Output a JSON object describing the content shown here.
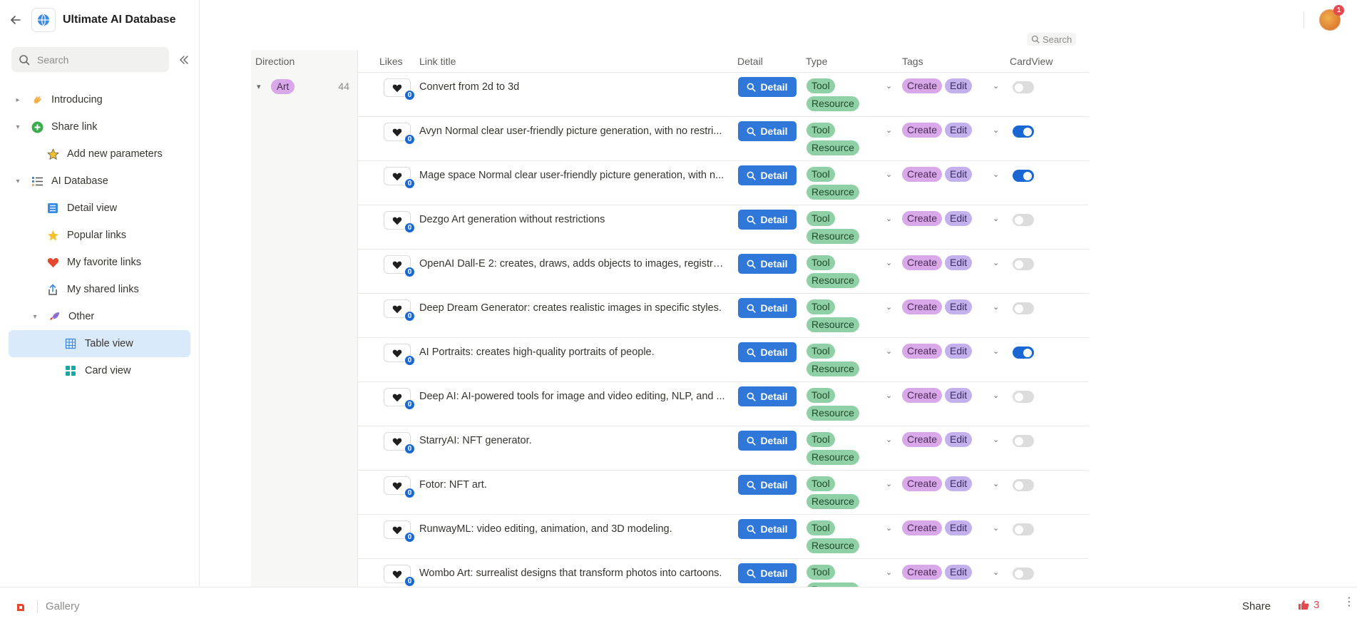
{
  "app": {
    "title": "Ultimate AI Database"
  },
  "sidebar": {
    "search_placeholder": "Search",
    "items": [
      {
        "label": "Introducing",
        "icon": "waving-hand-icon"
      },
      {
        "label": "Share link",
        "icon": "plus-circle-icon"
      },
      {
        "label": "Add new parameters",
        "icon": "sparkle-star-icon"
      },
      {
        "label": "AI Database",
        "icon": "list-icon"
      },
      {
        "label": "Detail view",
        "icon": "document-list-icon"
      },
      {
        "label": "Popular links",
        "icon": "star-icon"
      },
      {
        "label": "My favorite links",
        "icon": "heart-icon"
      },
      {
        "label": "My shared links",
        "icon": "share-upload-icon"
      },
      {
        "label": "Other",
        "icon": "rocket-icon"
      },
      {
        "label": "Table view",
        "icon": "table-grid-icon"
      },
      {
        "label": "Card view",
        "icon": "card-grid-icon"
      }
    ]
  },
  "table": {
    "search_label": "Search",
    "columns": {
      "direction": "Direction",
      "likes": "Likes",
      "link_title": "Link title",
      "detail": "Detail",
      "type": "Type",
      "tags": "Tags",
      "cardview": "CardView"
    },
    "group": {
      "name": "Art",
      "count": "44"
    },
    "detail_label": "Detail",
    "type_labels": {
      "tool": "Tool",
      "resource": "Resource"
    },
    "tag_labels": {
      "create": "Create",
      "edit": "Edit"
    },
    "rows": [
      {
        "likes": "0",
        "title": "Convert from 2d to 3d",
        "cardview": false
      },
      {
        "likes": "0",
        "title": "Avyn Normal clear user-friendly picture generation, with no restri...",
        "cardview": true
      },
      {
        "likes": "0",
        "title": "Mage space Normal clear user-friendly picture generation, with n...",
        "cardview": true
      },
      {
        "likes": "0",
        "title": "Dezgo Art generation without restrictions",
        "cardview": false
      },
      {
        "likes": "0",
        "title": "OpenAI Dall-E 2: creates, draws, adds objects to images, registra...",
        "cardview": false
      },
      {
        "likes": "0",
        "title": "Deep Dream Generator: creates realistic images in specific styles.",
        "cardview": false
      },
      {
        "likes": "0",
        "title": "AI Portraits: creates high-quality portraits of people.",
        "cardview": true
      },
      {
        "likes": "0",
        "title": "Deep AI: AI-powered tools for image and video editing, NLP, and ...",
        "cardview": false
      },
      {
        "likes": "0",
        "title": "StarryAI: NFT generator.",
        "cardview": false
      },
      {
        "likes": "0",
        "title": "Fotor: NFT art.",
        "cardview": false
      },
      {
        "likes": "0",
        "title": "RunwayML: video editing, animation, and 3D modeling.",
        "cardview": false
      },
      {
        "likes": "0",
        "title": "Wombo Art: surrealist designs that transform photos into cartoons.",
        "cardview": false
      }
    ]
  },
  "header": {
    "notification_count": "1"
  },
  "footer": {
    "gallery": "Gallery",
    "share": "Share",
    "likes": "3"
  },
  "colors": {
    "accent": "#2f77d8",
    "toggle_on": "#1967d2",
    "tag_green": "#8fd0a6",
    "tag_purple": "#d9a8e8",
    "active_nav": "#dbeafb"
  }
}
